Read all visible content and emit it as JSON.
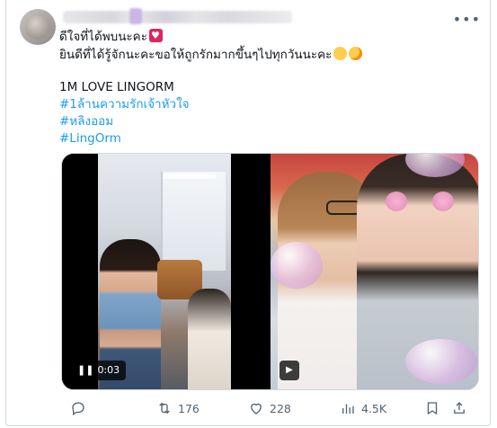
{
  "post": {
    "line1": "ดีใจที่ได้พบนะคะ",
    "line2": "ยินดีที่ได้รู้จักนะคะขอให้ถูกรักมากขึ้นๆไปทุกวันนะคะ",
    "line3": "1M LOVE LINGORM",
    "hashtags": [
      "#1ล้านความรักเจ้าหัวใจ",
      "#หลิงออม",
      "#LingOrm"
    ]
  },
  "media": {
    "video1": {
      "state": "playing",
      "time": "0:03"
    },
    "video2": {
      "state": "paused"
    }
  },
  "actions": {
    "reply_count": "",
    "retweet_count": "176",
    "like_count": "228",
    "view_count": "4.5K"
  },
  "colors": {
    "accent": "#1d9bf0",
    "text": "#0f1419",
    "muted": "#536471",
    "border": "#cfd9de"
  },
  "icons": [
    "more-icon",
    "reply-icon",
    "retweet-icon",
    "like-icon",
    "views-icon",
    "bookmark-icon",
    "share-icon",
    "pause-icon",
    "play-icon"
  ]
}
